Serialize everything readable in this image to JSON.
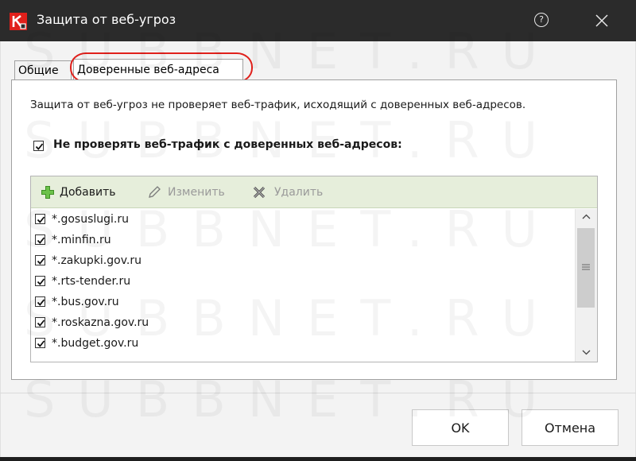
{
  "window": {
    "title": "Защита от веб-угроз",
    "help_icon": "help-circle-icon",
    "close_icon": "close-icon",
    "logo_icon": "kaspersky-logo-icon",
    "accent_color": "#e0201b"
  },
  "tabs": [
    {
      "label": "Общие",
      "active": false
    },
    {
      "label": "Доверенные веб-адреса",
      "active": true
    }
  ],
  "content": {
    "description": "Защита от веб-угроз не проверяет веб-трафик, исходящий с доверенных веб-адресов.",
    "skip_check": {
      "label": "Не проверять веб-трафик с доверенных веб-адресов:",
      "checked": true
    }
  },
  "toolbar": {
    "add_label": "Добавить",
    "edit_label": "Изменить",
    "delete_label": "Удалить",
    "add_icon": "plus-icon",
    "edit_icon": "pencil-icon",
    "delete_icon": "delete-x-icon"
  },
  "addresses": [
    {
      "label": "*.gosuslugi.ru",
      "checked": true
    },
    {
      "label": "*.minfin.ru",
      "checked": true
    },
    {
      "label": "*.zakupki.gov.ru",
      "checked": true
    },
    {
      "label": "*.rts-tender.ru",
      "checked": true
    },
    {
      "label": "*.bus.gov.ru",
      "checked": true
    },
    {
      "label": "*.roskazna.gov.ru",
      "checked": true
    },
    {
      "label": "*.budget.gov.ru",
      "checked": true
    }
  ],
  "buttons": {
    "ok_label": "OK",
    "cancel_label": "Отмена"
  },
  "watermark": "SUBBNET.RU"
}
